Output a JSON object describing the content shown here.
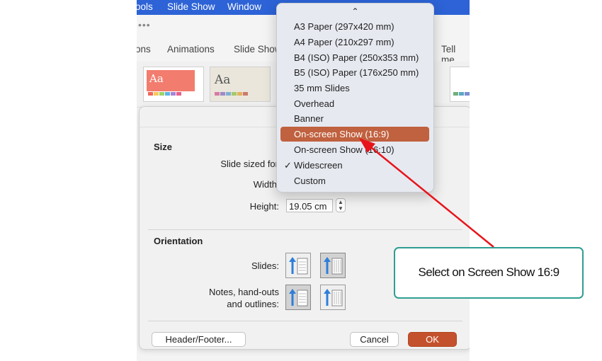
{
  "menubar": {
    "items": [
      "ools",
      "Slide Show",
      "Window"
    ]
  },
  "qat": {
    "overflow": "•••"
  },
  "ribbon_tabs": [
    "ons",
    "Animations",
    "Slide Show",
    "Tell me"
  ],
  "themes": [
    {
      "label": "Aa",
      "name": "red-theme"
    },
    {
      "label": "Aa",
      "name": "beige-theme"
    }
  ],
  "dialog": {
    "size_section": "Size",
    "slide_sized_for_label": "Slide sized for",
    "width_label": "Width",
    "height_label": "Height:",
    "height_value": "19.05 cm",
    "orientation_section": "Orientation",
    "slides_label": "Slides:",
    "notes_label_line1": "Notes, hand-outs",
    "notes_label_line2": "and outlines:",
    "header_footer_button": "Header/Footer...",
    "cancel_button": "Cancel",
    "ok_button": "OK"
  },
  "dropdown": {
    "scroll_up_glyph": "⌃",
    "items": [
      "A3 Paper (297x420 mm)",
      "A4 Paper (210x297 mm)",
      "B4 (ISO) Paper (250x353 mm)",
      "B5 (ISO) Paper (176x250 mm)",
      "35 mm Slides",
      "Overhead",
      "Banner",
      "On-screen Show (16:9)",
      "On-screen Show (16:10)",
      "Widescreen",
      "Custom"
    ],
    "highlighted": "On-screen Show (16:9)",
    "checked": "Widescreen",
    "check_glyph": "✓"
  },
  "callout": {
    "text": "Select on Screen Show 16:9"
  },
  "colors": {
    "accent_highlight": "#c0613f",
    "ok_button": "#c4512d",
    "menubar": "#2d63d6",
    "annotation_arrow": "#e8141b",
    "callout_border": "#2f9e91"
  }
}
